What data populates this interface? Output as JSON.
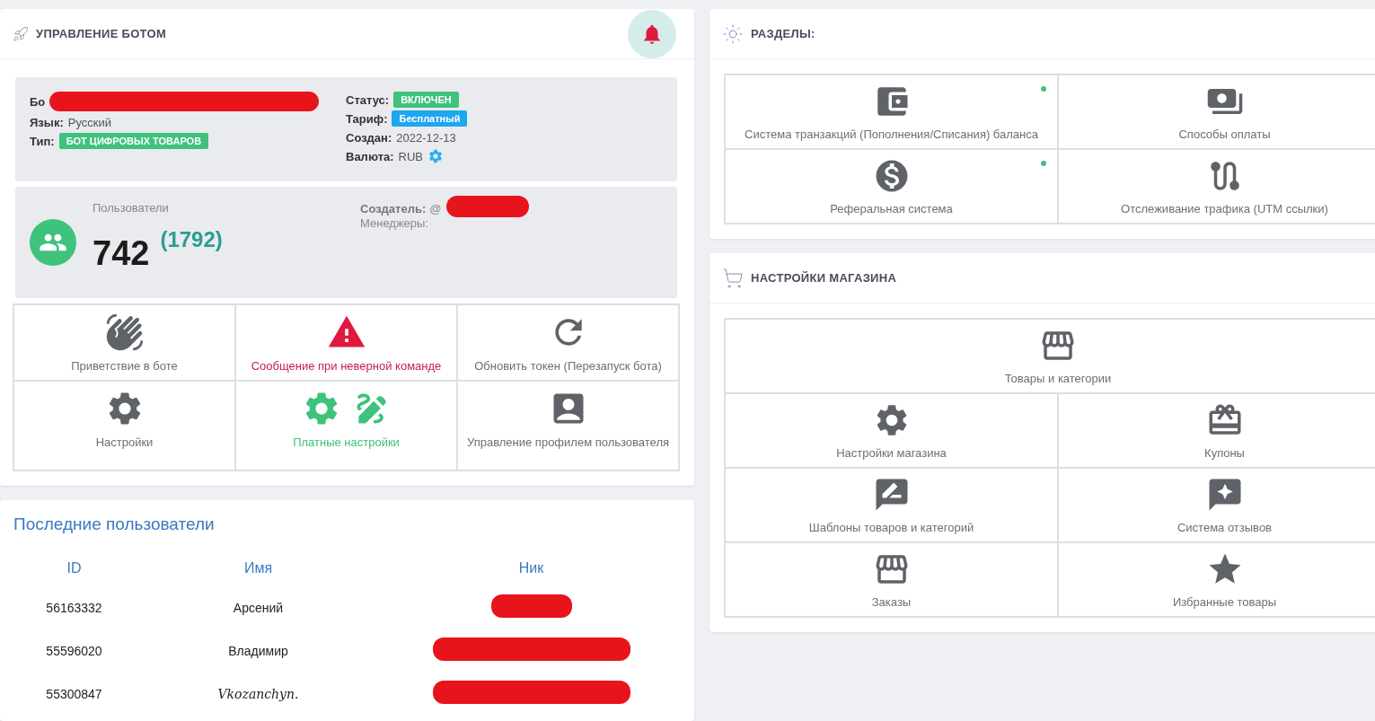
{
  "bot_panel": {
    "title": "УПРАВЛЕНИЕ БОТОМ",
    "info_left": [
      {
        "label": "Бо",
        "redacted": true
      },
      {
        "label": "Язык:",
        "value": "Русский"
      },
      {
        "label": "Тип:",
        "badge": "БОТ ЦИФРОВЫХ ТОВАРОВ",
        "color": "#3ec27c"
      }
    ],
    "info_right": [
      {
        "label": "Статус:",
        "badge": "ВКЛЮЧЕН",
        "color": "#3ec27c"
      },
      {
        "label": "Тариф:",
        "badge": "Бесплатный",
        "color": "#1ea7f0"
      },
      {
        "label": "Создан:",
        "value": "2022-12-13"
      },
      {
        "label": "Валюта:",
        "value": "RUB",
        "gear": true
      }
    ],
    "users_label": "Пользователи",
    "users_count": "742",
    "users_total": "(1792)",
    "creator_label": "Создатель:",
    "creator_value": "@",
    "managers_label": "Менеджеры:",
    "tiles": [
      {
        "label": "Приветствие в боте",
        "kind": "plain"
      },
      {
        "label": "Сообщение при неверной команде",
        "kind": "danger"
      },
      {
        "label": "Обновить токен (Перезапуск бота)",
        "kind": "plain"
      },
      {
        "label": "Настройки",
        "kind": "plain"
      },
      {
        "label": "Платные настройки",
        "kind": "success"
      },
      {
        "label": "Управление профилем пользователя",
        "kind": "plain"
      }
    ]
  },
  "recent_users": {
    "title": "Последние пользователи",
    "columns": [
      "ID",
      "Имя",
      "Ник"
    ],
    "rows": [
      {
        "id": "56163332",
        "name": "Арсений",
        "fancy": false
      },
      {
        "id": "55596020",
        "name": "Владимир",
        "fancy": false
      },
      {
        "id": "55300847",
        "name": "Vkozanchyn.",
        "fancy": true
      }
    ]
  },
  "sections": {
    "title": "РАЗДЕЛЫ:",
    "tiles": [
      {
        "label": "Система транзакций (Пополнения/Списания) баланса",
        "dot": true
      },
      {
        "label": "Способы оплаты",
        "dot": false
      },
      {
        "label": "Реферальная система",
        "dot": true
      },
      {
        "label": "Отслеживание трафика (UTM ссылки)",
        "dot": false
      }
    ]
  },
  "shop_settings": {
    "title": "НАСТРОЙКИ МАГАЗИНА",
    "tiles": [
      {
        "label": "Товары и категории",
        "wide": true
      },
      {
        "label": "Настройки магазина",
        "wide": false
      },
      {
        "label": "Купоны",
        "wide": false
      },
      {
        "label": "Шаблоны товаров и категорий",
        "wide": false
      },
      {
        "label": "Система отзывов",
        "wide": false
      },
      {
        "label": "Заказы",
        "wide": false
      },
      {
        "label": "Избранные товары",
        "wide": false
      }
    ]
  }
}
